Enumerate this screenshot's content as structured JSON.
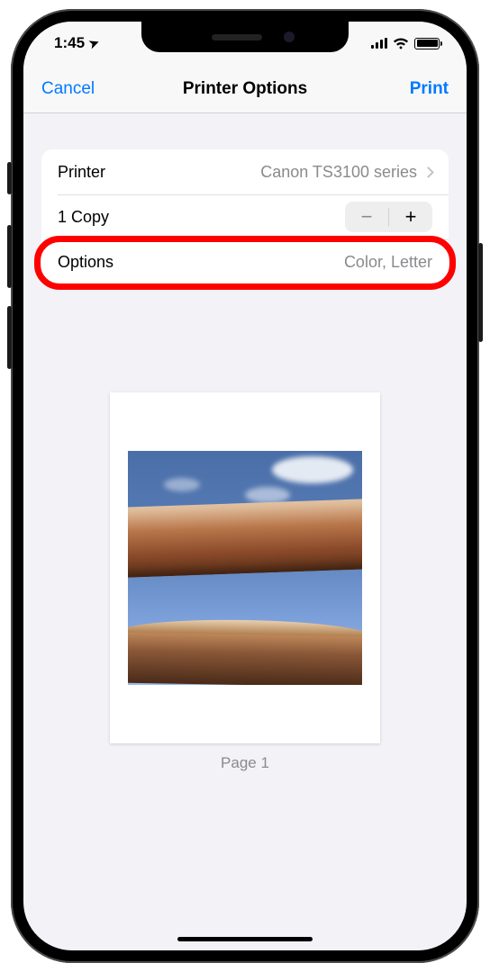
{
  "status": {
    "time": "1:45",
    "location_glyph": "➤"
  },
  "nav": {
    "cancel": "Cancel",
    "title": "Printer Options",
    "print": "Print"
  },
  "rows": {
    "printer_label": "Printer",
    "printer_value": "Canon TS3100 series",
    "copies_label": "1 Copy",
    "options_label": "Options",
    "options_value": "Color, Letter"
  },
  "stepper": {
    "minus": "−",
    "plus": "+"
  },
  "preview": {
    "page_label": "Page 1"
  }
}
